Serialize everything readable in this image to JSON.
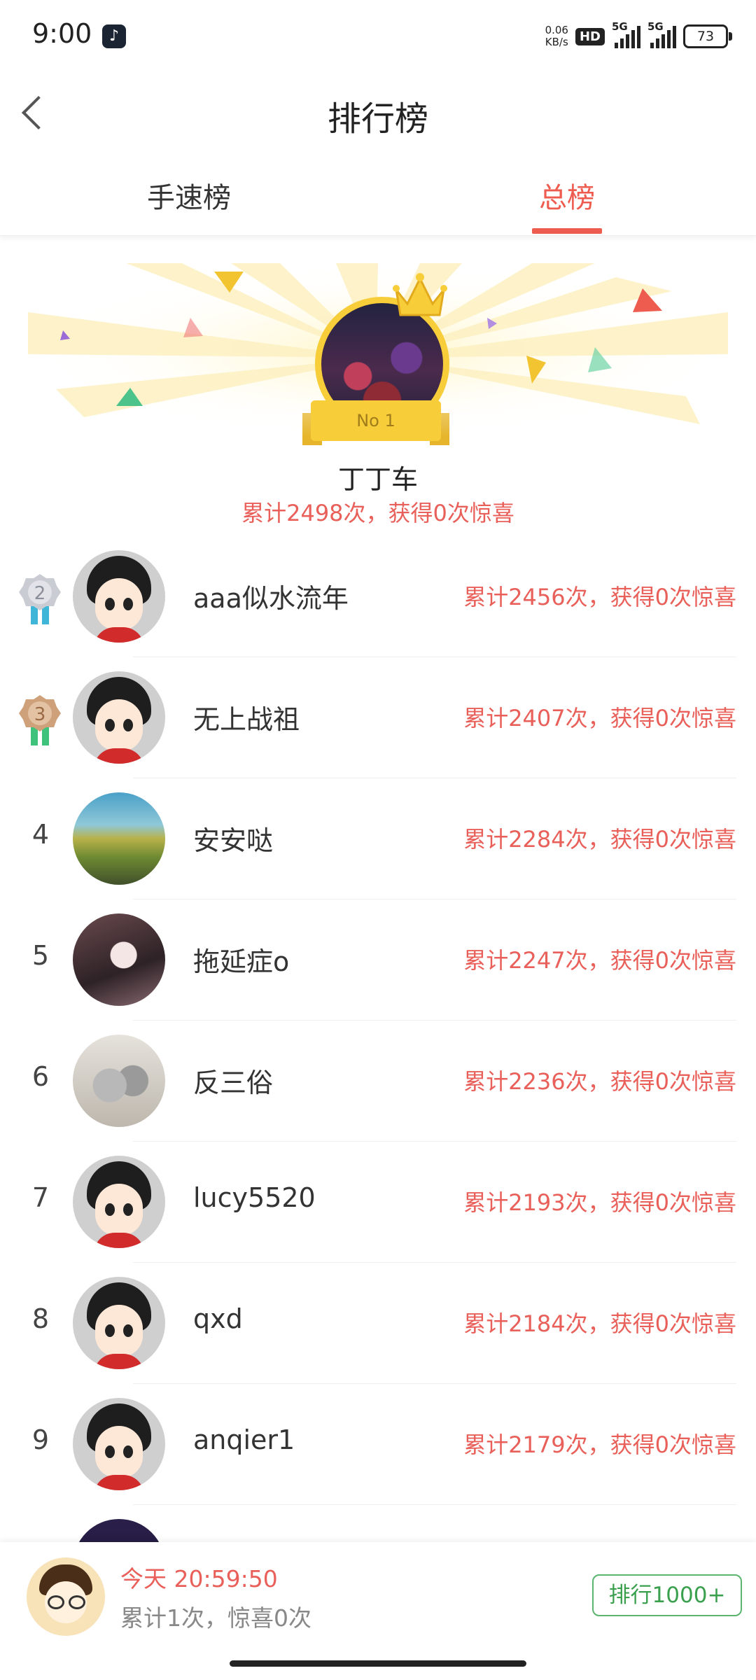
{
  "status_bar": {
    "time": "9:00",
    "app_icon": "tiktok-icon",
    "speed_value": "0.06",
    "speed_unit": "KB/s",
    "hd": "HD",
    "net1": "5G",
    "net2": "5G",
    "battery": "73"
  },
  "nav": {
    "title": "排行榜",
    "back_icon": "chevron-left-icon"
  },
  "tabs": [
    {
      "label": "手速榜",
      "active": false
    },
    {
      "label": "总榜",
      "active": true
    }
  ],
  "champion": {
    "badge": "No 1",
    "name": "丁丁车",
    "stats": "累计2498次，获得0次惊喜"
  },
  "rankings": [
    {
      "rank": "2",
      "name": "aaa似水流年",
      "stats": "累计2456次，获得0次惊喜",
      "avatar": "default-cartoon",
      "medal": "silver"
    },
    {
      "rank": "3",
      "name": "无上战祖",
      "stats": "累计2407次，获得0次惊喜",
      "avatar": "default-cartoon",
      "medal": "bronze"
    },
    {
      "rank": "4",
      "name": "安安哒",
      "stats": "累计2284次，获得0次惊喜",
      "avatar": "landscape"
    },
    {
      "rank": "5",
      "name": "拖延症o",
      "stats": "累计2247次，获得0次惊喜",
      "avatar": "anime-girl"
    },
    {
      "rank": "6",
      "name": "反三俗",
      "stats": "累计2236次，获得0次惊喜",
      "avatar": "cat"
    },
    {
      "rank": "7",
      "name": "lucy5520",
      "stats": "累计2193次，获得0次惊喜",
      "avatar": "default-cartoon"
    },
    {
      "rank": "8",
      "name": "qxd",
      "stats": "累计2184次，获得0次惊喜",
      "avatar": "default-cartoon"
    },
    {
      "rank": "9",
      "name": "anqier1",
      "stats": "累计2179次，获得0次惊喜",
      "avatar": "default-cartoon"
    }
  ],
  "me": {
    "time": "今天 20:59:50",
    "stats": "累计1次，惊喜0次",
    "rank_button": "排行1000+"
  },
  "colors": {
    "accent": "#ee5b4f",
    "stats_red": "#e9605a",
    "gold": "#f8cd3a",
    "button_green": "#3aa04e"
  }
}
